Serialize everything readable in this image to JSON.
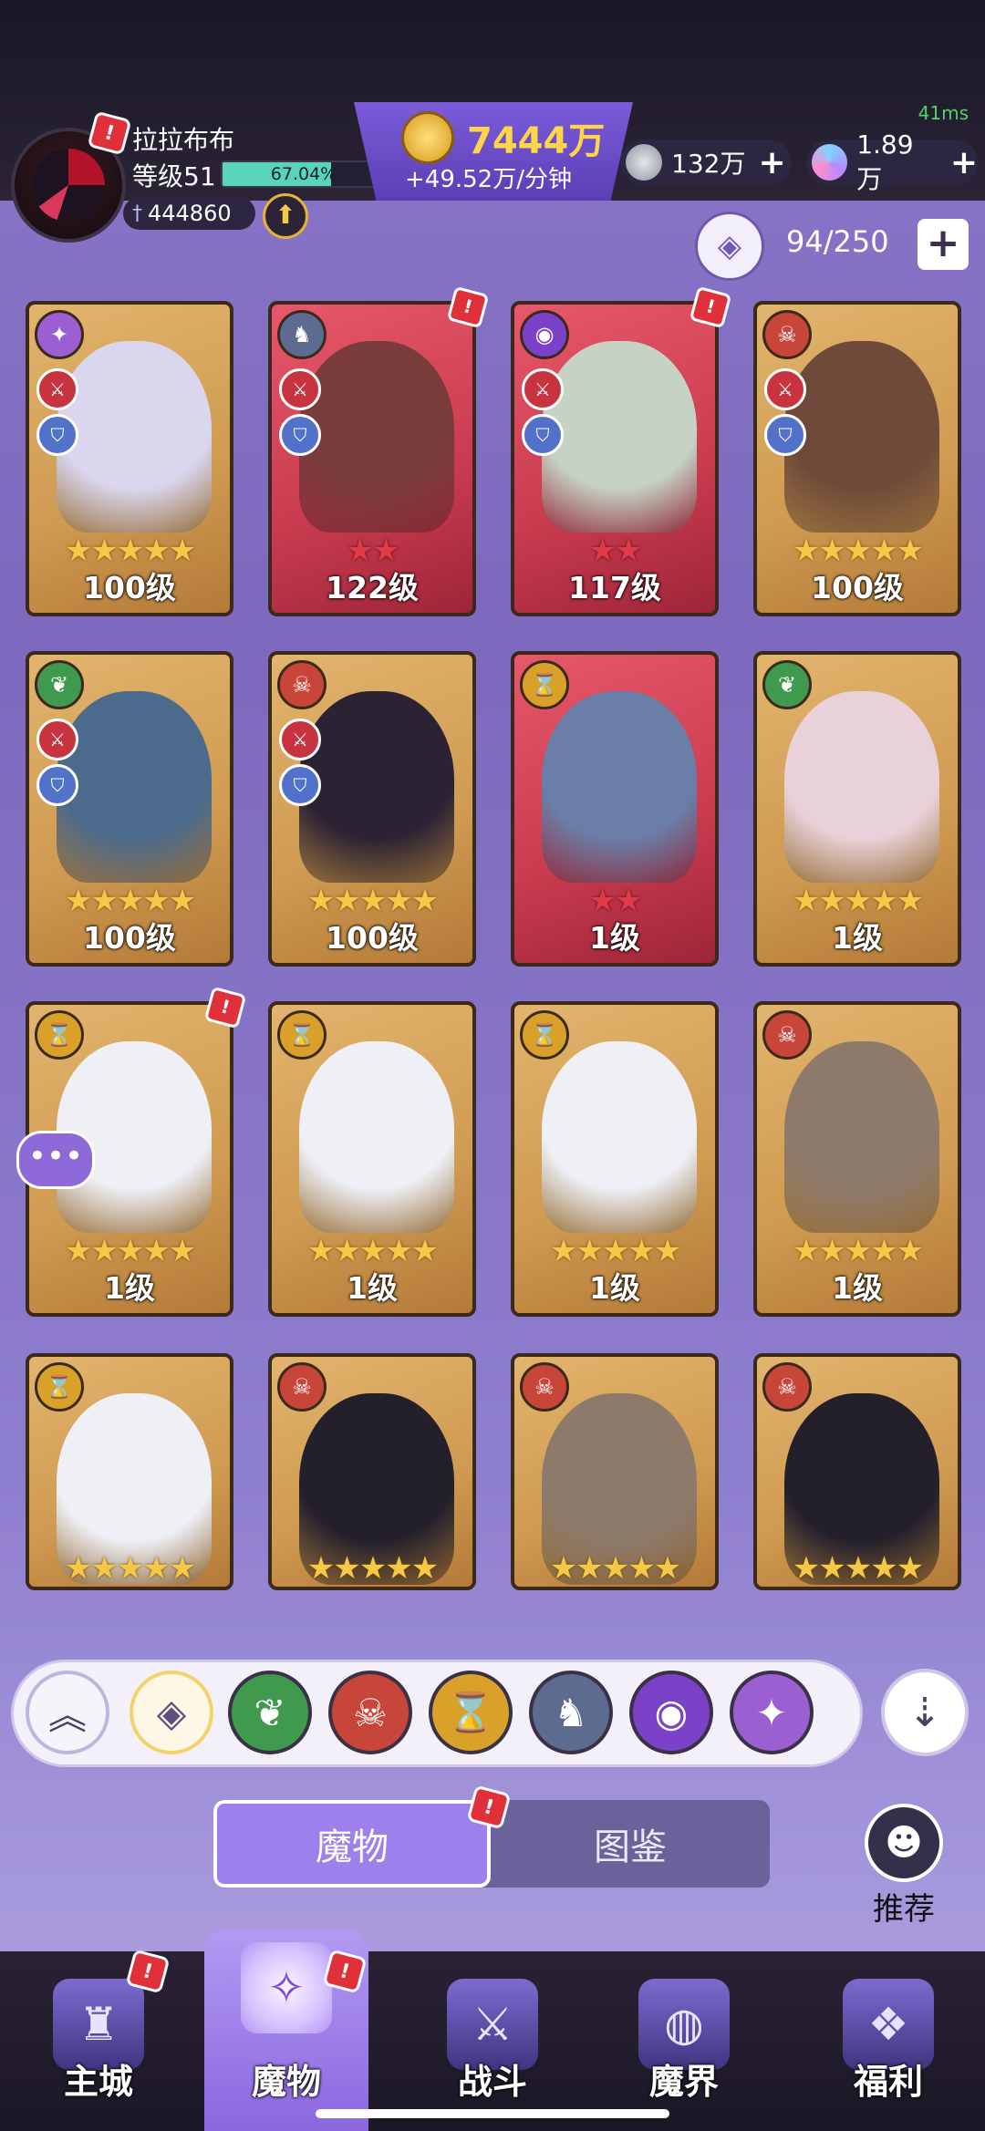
{
  "status": {
    "ping": "41ms"
  },
  "player": {
    "name": "拉拉布布",
    "level_label": "等级51",
    "xp_percent_text": "67.04%",
    "xp_fraction": 0.6704,
    "power": "444860"
  },
  "currency": {
    "gold": "7444万",
    "gold_rate": "+49.52万/分钟",
    "silver": "132万",
    "gems": "1.89万"
  },
  "collection": {
    "count": "94/250"
  },
  "cards": [
    {
      "level": "100级",
      "stars": "★★★★★",
      "star_color": "gold",
      "frame": "gold",
      "element": "star-element",
      "element_color": "#9c5fd1",
      "roles": [
        "sword",
        "shield"
      ],
      "art_color": "#d9d6ee",
      "alert": false
    },
    {
      "level": "122级",
      "stars": "★★",
      "star_color": "red",
      "frame": "red",
      "element": "dragon-element",
      "element_color": "#5c6b8f",
      "roles": [
        "sword",
        "shield"
      ],
      "art_color": "#7a3b3b",
      "alert": true
    },
    {
      "level": "117级",
      "stars": "★★",
      "star_color": "red",
      "frame": "red",
      "element": "eye-element",
      "element_color": "#7b42c9",
      "roles": [
        "sword",
        "shield"
      ],
      "art_color": "#c5d2c4",
      "alert": true
    },
    {
      "level": "100级",
      "stars": "★★★★★",
      "star_color": "gold",
      "frame": "gold",
      "element": "demon-element",
      "element_color": "#c8453a",
      "roles": [
        "sword",
        "shield"
      ],
      "art_color": "#6f4a3a",
      "alert": false
    },
    {
      "level": "100级",
      "stars": "★★★★★",
      "star_color": "gold",
      "frame": "gold",
      "element": "leaf-element",
      "element_color": "#3f9a4e",
      "roles": [
        "sword",
        "shield"
      ],
      "art_color": "#4c6a8c",
      "alert": false
    },
    {
      "level": "100级",
      "stars": "★★★★★",
      "star_color": "gold",
      "frame": "gold",
      "element": "demon-element",
      "element_color": "#c8453a",
      "roles": [
        "sword",
        "shield"
      ],
      "art_color": "#2b2233",
      "alert": false
    },
    {
      "level": "1级",
      "stars": "★★",
      "star_color": "red",
      "frame": "red",
      "element": "hourglass-element",
      "element_color": "#d9a12a",
      "roles": [],
      "art_color": "#6a7ea8",
      "alert": false
    },
    {
      "level": "1级",
      "stars": "★★★★★",
      "star_color": "gold",
      "frame": "gold",
      "element": "leaf-element",
      "element_color": "#3f9a4e",
      "roles": [],
      "art_color": "#e8d1d8",
      "alert": false
    },
    {
      "level": "1级",
      "stars": "★★★★★",
      "star_color": "gold",
      "frame": "gold",
      "element": "hourglass-element",
      "element_color": "#d9a12a",
      "roles": [],
      "art_color": "#eef0f6",
      "alert": true
    },
    {
      "level": "1级",
      "stars": "★★★★★",
      "star_color": "gold",
      "frame": "gold",
      "element": "hourglass-element",
      "element_color": "#d9a12a",
      "roles": [],
      "art_color": "#eef0f6",
      "alert": false
    },
    {
      "level": "1级",
      "stars": "★★★★★",
      "star_color": "gold",
      "frame": "gold",
      "element": "hourglass-element",
      "element_color": "#d9a12a",
      "roles": [],
      "art_color": "#eef0f6",
      "alert": false
    },
    {
      "level": "1级",
      "stars": "★★★★★",
      "star_color": "gold",
      "frame": "gold",
      "element": "demon-element",
      "element_color": "#c8453a",
      "roles": [],
      "art_color": "#8d7a6b",
      "alert": false
    },
    {
      "level": "",
      "stars": "★★★★★",
      "star_color": "gold",
      "frame": "gold",
      "element": "hourglass-element",
      "element_color": "#d9a12a",
      "roles": [],
      "art_color": "#eef0f6",
      "alert": false
    },
    {
      "level": "",
      "stars": "★★★★★",
      "star_color": "gold",
      "frame": "gold",
      "element": "demon-element",
      "element_color": "#c8453a",
      "roles": [],
      "art_color": "#23202c",
      "alert": false
    },
    {
      "level": "",
      "stars": "★★★★★",
      "star_color": "gold",
      "frame": "gold",
      "element": "demon-element",
      "element_color": "#c8453a",
      "roles": [],
      "art_color": "#8d7a6b",
      "alert": false
    },
    {
      "level": "",
      "stars": "★★★★★",
      "star_color": "gold",
      "frame": "gold",
      "element": "demon-element",
      "element_color": "#c8453a",
      "roles": [],
      "art_color": "#23202c",
      "alert": false
    }
  ],
  "filters": [
    {
      "name": "all-filter-icon",
      "glyph": "◈",
      "color": "#fff7e6",
      "selected": true
    },
    {
      "name": "leaf-filter-icon",
      "glyph": "❦",
      "color": "#3f9a4e",
      "selected": false
    },
    {
      "name": "demon-filter-icon",
      "glyph": "☠",
      "color": "#c8453a",
      "selected": false
    },
    {
      "name": "hourglass-filter-icon",
      "glyph": "⌛",
      "color": "#d9a12a",
      "selected": false
    },
    {
      "name": "dragon-filter-icon",
      "glyph": "♞",
      "color": "#5c6b8f",
      "selected": false
    },
    {
      "name": "eye-filter-icon",
      "glyph": "◉",
      "color": "#7b42c9",
      "selected": false
    },
    {
      "name": "star-filter-icon",
      "glyph": "✦",
      "color": "#9c5fd1",
      "selected": false
    }
  ],
  "tabs": {
    "monsters": "魔物",
    "codex": "图鉴"
  },
  "recommend_label": "推荐",
  "nav": {
    "home": "主城",
    "monsters": "魔物",
    "battle": "战斗",
    "realm": "魔界",
    "welfare": "福利"
  }
}
